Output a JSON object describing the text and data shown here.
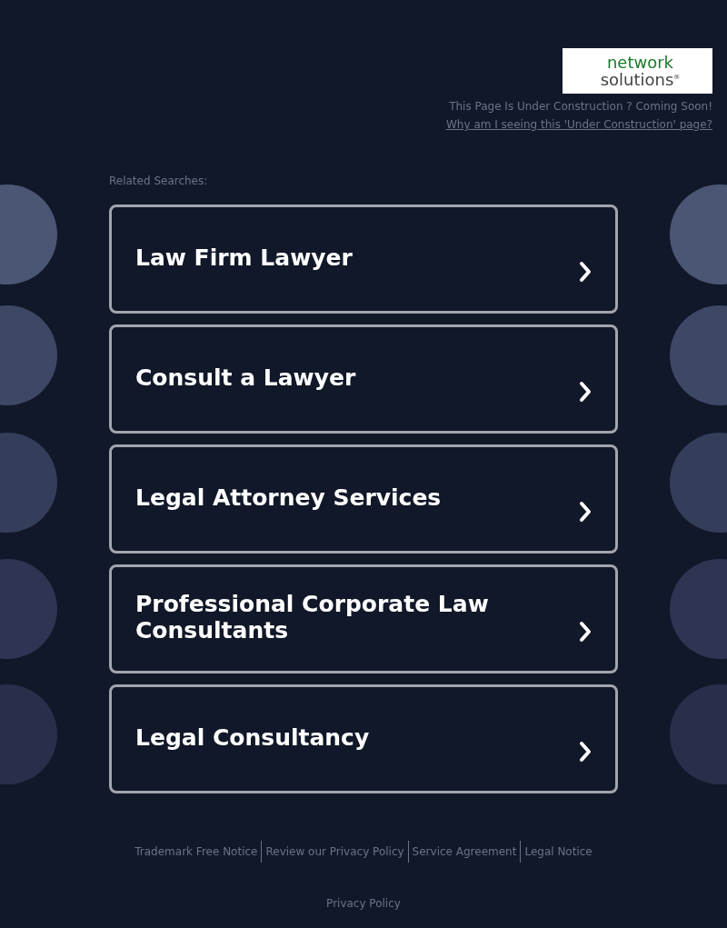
{
  "logo": {
    "line_1": "network",
    "line_2": "solutions$^{®}$"
  },
  "header": {
    "notice": "This Page Is Under Construction ? Coming Soon!",
    "link": "Why am I seeing this 'Under Construction' page?"
  },
  "related_searches": {
    "label": "Related Searches:",
    "items": [
      {
        "label": "Law Firm Lawyer"
      },
      {
        "label": "Consult a Lawyer"
      },
      {
        "label": "Legal Attorney Services"
      },
      {
        "label": "Professional Corporate Law Consultants"
      },
      {
        "label": "Legal Consultancy"
      }
    ]
  },
  "footer": {
    "links": [
      "Trademark Free Notice",
      "Review our Privacy Policy",
      "Service Agreement",
      "Legal Notice"
    ],
    "privacy": "Privacy Policy"
  }
}
